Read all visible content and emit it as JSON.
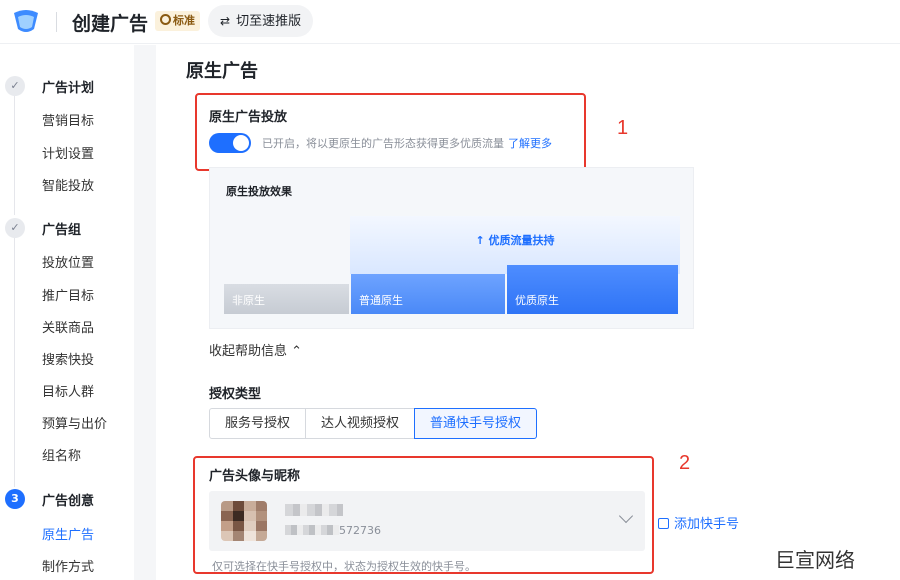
{
  "header": {
    "title": "创建广告",
    "badge": "标准",
    "switch_label": "切至速推版"
  },
  "sidebar": {
    "groups": [
      {
        "step": "✓",
        "label": "广告计划",
        "items": [
          "营销目标",
          "计划设置",
          "智能投放"
        ]
      },
      {
        "step": "✓",
        "label": "广告组",
        "items": [
          "投放位置",
          "推广目标",
          "关联商品",
          "搜索快投",
          "目标人群",
          "预算与出价",
          "组名称"
        ]
      },
      {
        "step": "3",
        "label": "广告创意",
        "items": [
          "原生广告",
          "制作方式"
        ]
      }
    ]
  },
  "main": {
    "title": "原生广告",
    "native": {
      "label": "原生广告投放",
      "toggle_on": true,
      "desc": "已开启，将以更原生的广告形态获得更多优质流量",
      "learn_more": "了解更多"
    },
    "effect": {
      "title": "原生投放效果",
      "uplift": "↑ 优质流量扶持",
      "bars": [
        "非原生",
        "普通原生",
        "优质原生"
      ]
    },
    "collapse_label": "收起帮助信息 ⌃",
    "auth": {
      "title": "授权类型",
      "options": [
        "服务号授权",
        "达人视频授权",
        "普通快手号授权"
      ],
      "selected": "普通快手号授权"
    },
    "avatar": {
      "title": "广告头像与昵称",
      "account_id_suffix": "572736",
      "hint": "仅可选择在快手号授权中，状态为授权生效的快手号。",
      "add_label": "添加快手号"
    }
  },
  "annotations": [
    "1",
    "2"
  ],
  "watermark": "巨宣网络",
  "colors": {
    "accent": "#1e6fff",
    "annotation": "#e8382d"
  }
}
